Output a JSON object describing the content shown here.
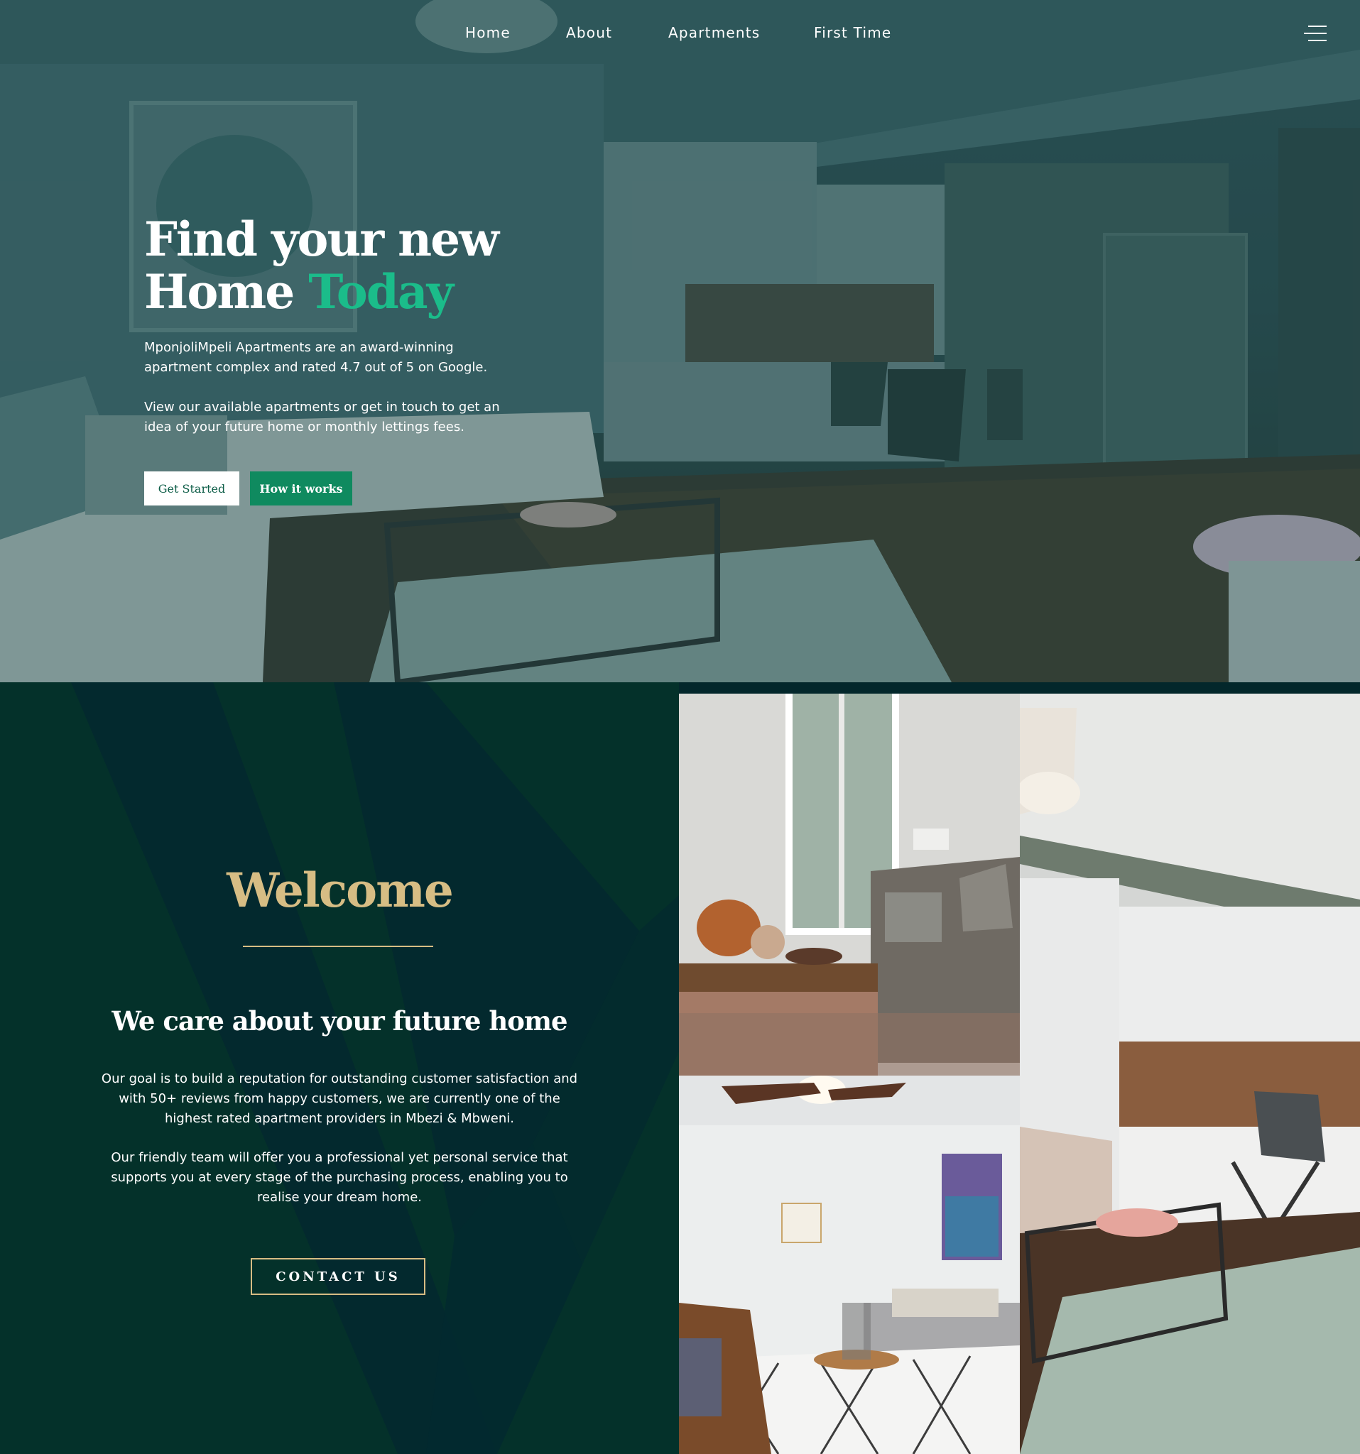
{
  "nav": {
    "items": [
      {
        "label": "Home"
      },
      {
        "label": "About"
      },
      {
        "label": "Apartments"
      },
      {
        "label": "First Time"
      }
    ],
    "menu_icon": "hamburger-menu-icon"
  },
  "hero": {
    "title_line1": "Find your new",
    "title_line2": "Home",
    "title_accent": "Today",
    "paragraph1": "MponjoliMpeli Apartments are an award-winning apartment complex and rated 4.7 out of 5 on Google.",
    "paragraph2": "View our available apartments or get in touch to get an idea of your future home or monthly lettings fees.",
    "primary_button": "Get Started",
    "secondary_button": "How it works"
  },
  "welcome": {
    "title": "Welcome",
    "subtitle": "We care about your future home",
    "paragraph1": "Our goal is to build a reputation for outstanding customer satisfaction and with 50+ reviews from happy customers, we are currently one of the highest rated apartment providers in Mbezi & Mbweni.",
    "paragraph2": "Our friendly team will offer you a professional yet personal service that supports you at every stage of the purchasing process, enabling you to realise your dream home.",
    "button": "CONTACT US"
  },
  "colors": {
    "accent_green": "#1bbc8a",
    "button_green": "#0f8a5f",
    "gold": "#d7bd84",
    "dark_green": "#04312a"
  }
}
